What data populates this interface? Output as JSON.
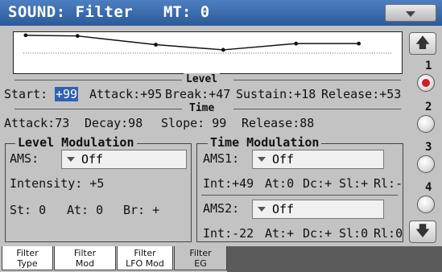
{
  "header": {
    "title": "SOUND: Filter",
    "mt": "MT: 0"
  },
  "envelope": {
    "start": 99,
    "attack": 95,
    "break": 47,
    "sustain": 18,
    "release": 53,
    "release_end": 53
  },
  "level": {
    "heading": "Level",
    "start_label": "Start:",
    "start_value": "+99",
    "attack": "Attack:+95",
    "break": "Break:+47",
    "sustain": "Sustain:+18",
    "release": "Release:+53"
  },
  "time": {
    "heading": "Time",
    "attack": "Attack:73",
    "decay": "Decay:98",
    "slope": "Slope: 99",
    "release": "Release:88"
  },
  "level_mod": {
    "title": "Level Modulation",
    "ams_label": "AMS:",
    "ams_value": "Off",
    "intensity": "Intensity: +5",
    "st": "St: 0",
    "at": "At: 0",
    "br": "Br: +"
  },
  "time_mod": {
    "title": "Time Modulation",
    "ams1_label": "AMS1:",
    "ams1_value": "Off",
    "int1": "Int:+49",
    "at1": "At:0",
    "dc1": "Dc:+",
    "sl1": "Sl:+",
    "rl1": "Rl:-",
    "ams2_label": "AMS2:",
    "ams2_value": "Off",
    "int2": "Int:-22",
    "at2": "At:+",
    "dc2": "Dc:+",
    "sl2": "Sl:0",
    "rl2": "Rl:0"
  },
  "sidebar": {
    "numbers": [
      "1",
      "2",
      "3",
      "4"
    ],
    "selected": "1"
  },
  "tabs": [
    {
      "l1": "Filter",
      "l2": "Type"
    },
    {
      "l1": "Filter",
      "l2": "Mod"
    },
    {
      "l1": "Filter",
      "l2": "LFO Mod"
    },
    {
      "l1": "Filter",
      "l2": "EG"
    }
  ],
  "colors": {
    "titlebar": "#2c5a9a",
    "highlight": "#2f61b0",
    "panel": "#c3c3c3",
    "selected_radio": "#d21c28"
  }
}
